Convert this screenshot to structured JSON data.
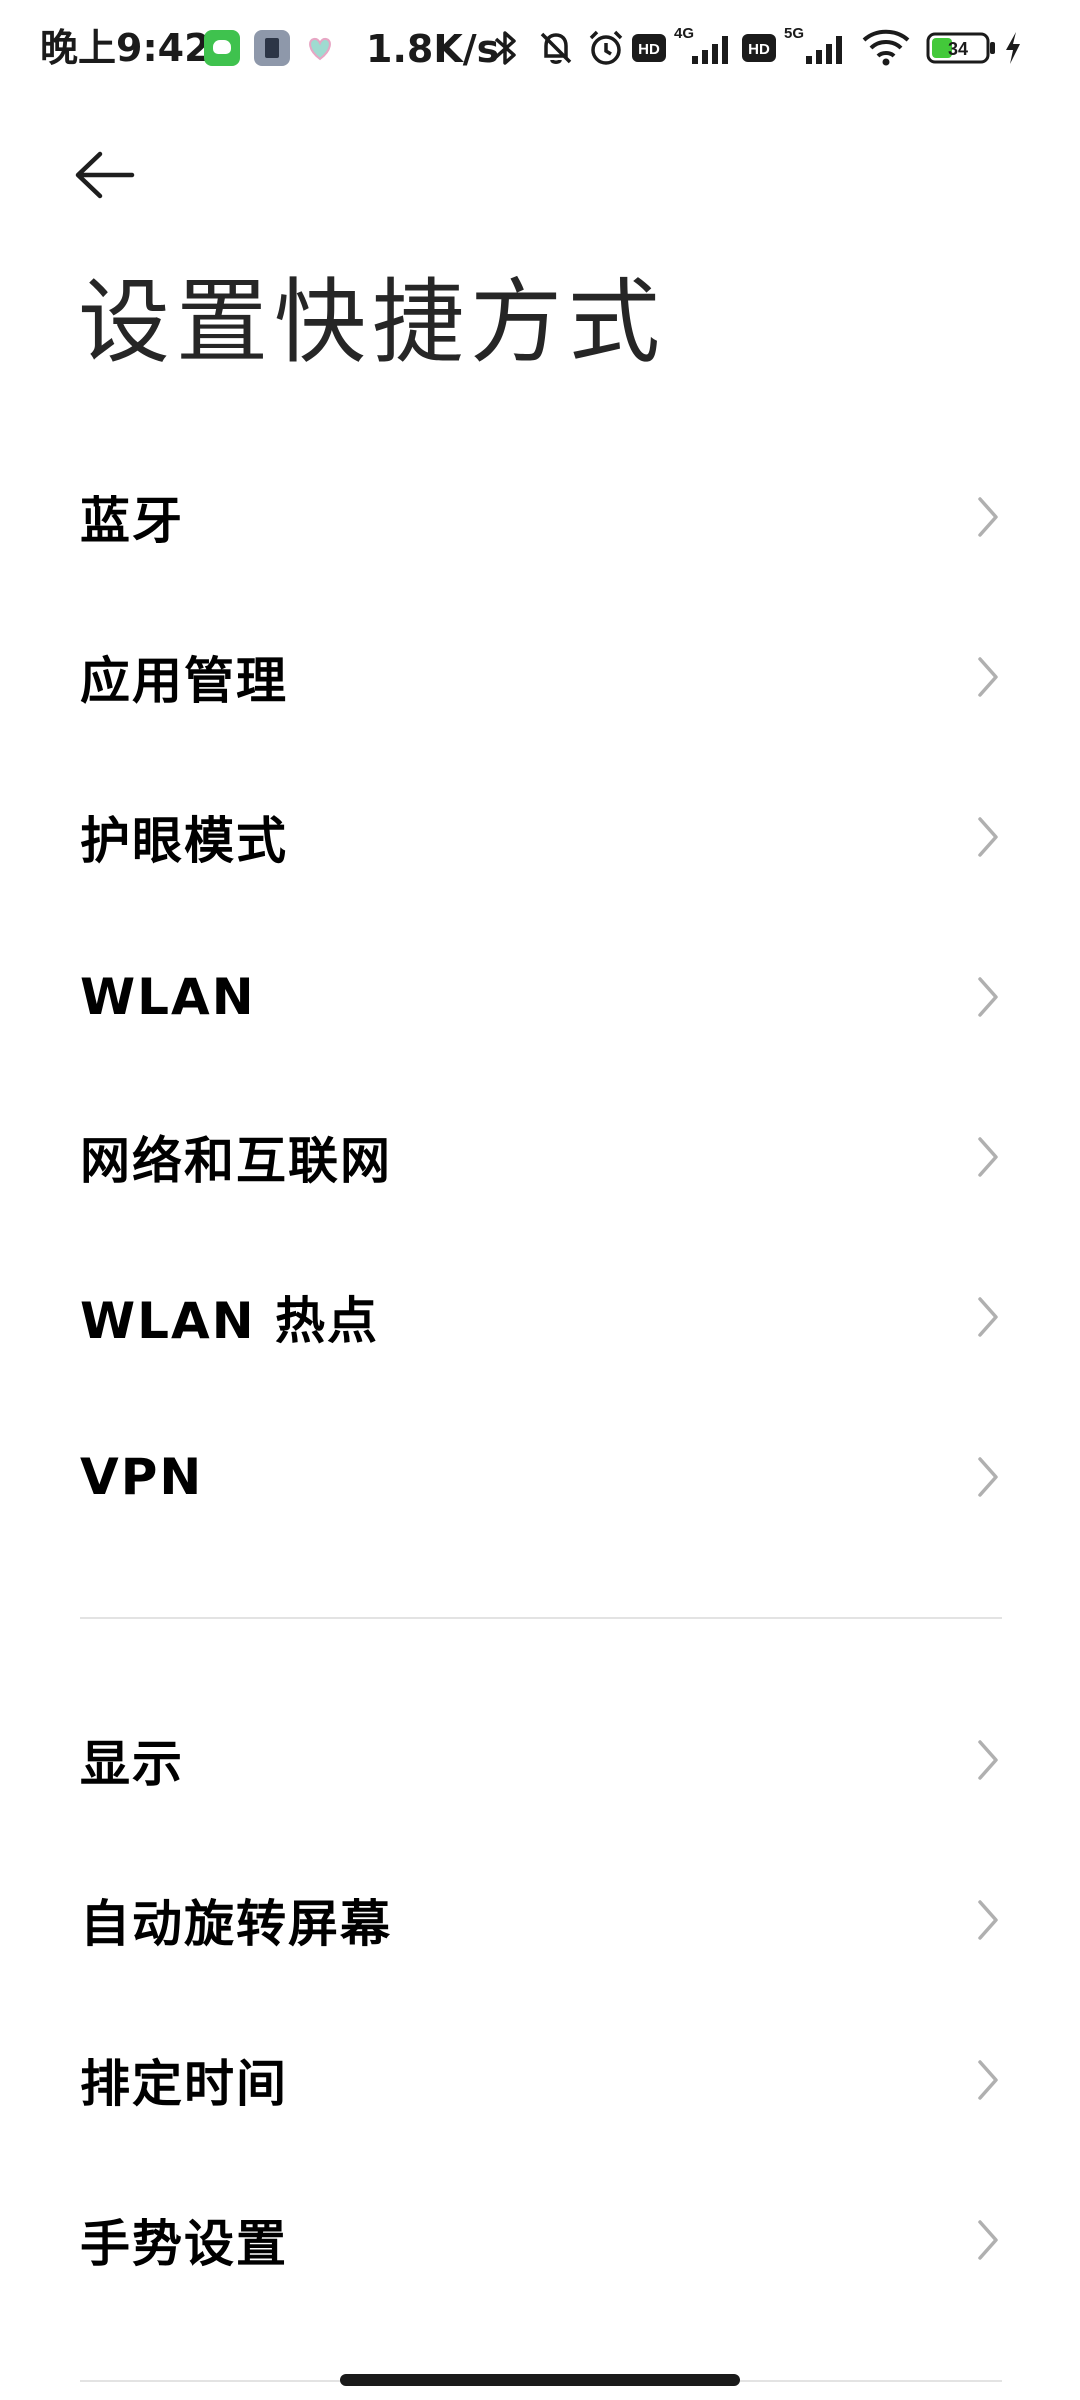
{
  "status_bar": {
    "time": "晚上9:42",
    "net_speed": "1.8K/s",
    "battery_level": "34",
    "sim1_label": "4G",
    "sim2_label": "5G",
    "hd_label": "HD",
    "icons": [
      "app-green-icon",
      "app-slate-icon",
      "heart-icon",
      "bluetooth-icon",
      "mute-bell-icon",
      "alarm-icon",
      "hd-icon",
      "signal-4g-icon",
      "hd-icon",
      "signal-5g-icon",
      "wifi-icon",
      "battery-icon",
      "charging-icon"
    ]
  },
  "header": {
    "back_icon": "back-arrow-icon",
    "title": "设置快捷方式"
  },
  "groups": [
    {
      "items": [
        {
          "label": "蓝牙"
        },
        {
          "label": "应用管理"
        },
        {
          "label": "护眼模式"
        },
        {
          "label": "WLAN"
        },
        {
          "label": "网络和互联网"
        },
        {
          "label": "WLAN 热点"
        },
        {
          "label": "VPN"
        }
      ]
    },
    {
      "items": [
        {
          "label": "显示"
        },
        {
          "label": "自动旋转屏幕"
        },
        {
          "label": "排定时间"
        },
        {
          "label": "手势设置"
        }
      ]
    }
  ],
  "colors": {
    "background": "#ffffff",
    "label": "#000000",
    "title": "#262626",
    "chevron": "#b0b0b0",
    "divider": "#e3e3e3",
    "battery_fill": "#43c93a"
  }
}
